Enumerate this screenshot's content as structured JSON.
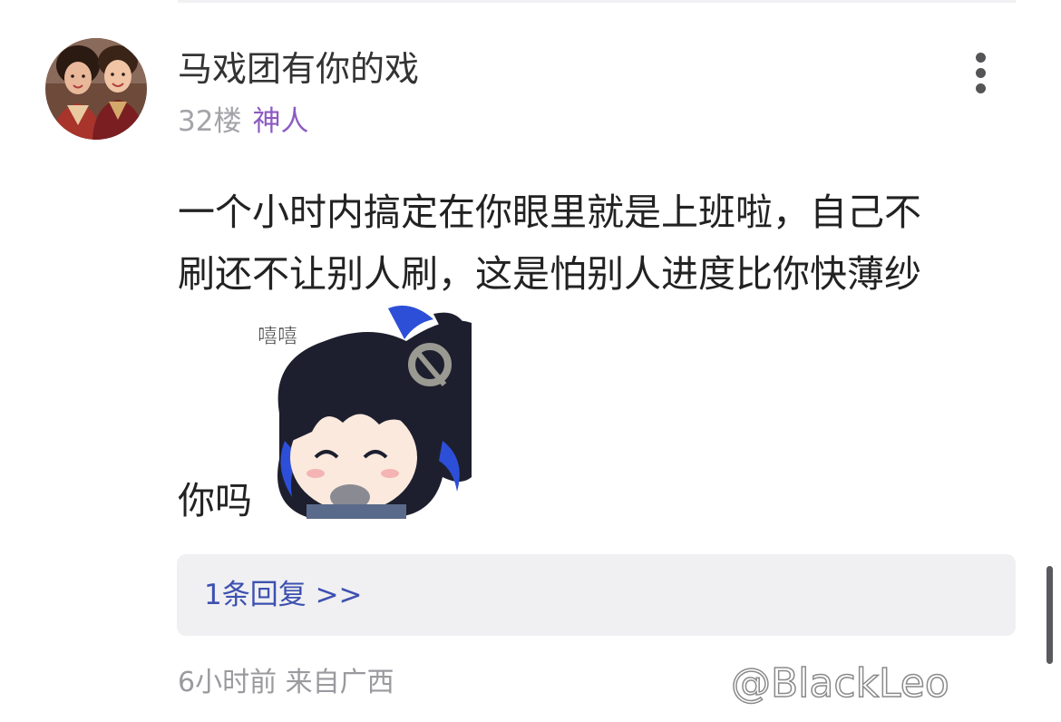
{
  "post": {
    "username": "马戏团有你的戏",
    "floor": "32楼",
    "badge": "神人",
    "content_lines": [
      "一个小时内搞定在你眼里就是上班啦，自己不",
      "刷还不让别人刷，这是怕别人进度比你快薄纱"
    ],
    "content_tail": "你吗",
    "sticker": {
      "caption": "嘻嘻",
      "icon": "smiling-anime-girl-sticker"
    },
    "reply_link": "1条回复 >>",
    "timestamp": "6小时前",
    "location": "来自广西"
  },
  "watermark": "@BlackLeo",
  "icons": {
    "more": "more-vertical-icon",
    "avatar": "user-avatar-photo"
  },
  "colors": {
    "badge": "#8e5bc2",
    "reply_link": "#3d51b0",
    "reply_box_bg": "#f0f0f2",
    "muted_text": "#9a9a9f"
  }
}
